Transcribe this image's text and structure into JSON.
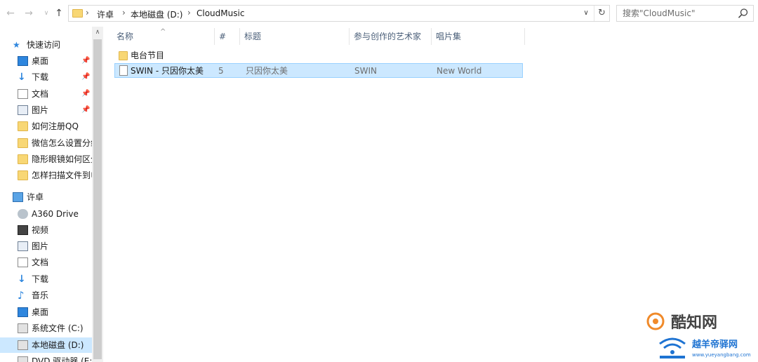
{
  "toolbar": {
    "back_icon": "arrow-left-icon",
    "forward_icon": "arrow-right-icon",
    "recent_icon": "chevron-down-icon",
    "up_icon": "arrow-up-icon"
  },
  "address": {
    "breadcrumbs": [
      "许卓",
      "本地磁盘 (D:)",
      "CloudMusic"
    ],
    "dropdown_icon": "chevron-down-icon",
    "refresh_icon": "refresh-icon"
  },
  "search": {
    "placeholder": "搜索\"CloudMusic\"",
    "icon": "search-icon"
  },
  "sidebar": {
    "quick_access": {
      "label": "快速访问",
      "items": [
        {
          "label": "桌面",
          "icon": "desktop-icon",
          "pinned": true
        },
        {
          "label": "下载",
          "icon": "download-icon",
          "pinned": true
        },
        {
          "label": "文档",
          "icon": "document-icon",
          "pinned": true
        },
        {
          "label": "图片",
          "icon": "pictures-icon",
          "pinned": true
        },
        {
          "label": "如何注册QQ",
          "icon": "folder-icon",
          "pinned": false
        },
        {
          "label": "微信怎么设置分组",
          "icon": "folder-icon",
          "pinned": false
        },
        {
          "label": "隐形眼镜如何区分",
          "icon": "folder-icon",
          "pinned": false
        },
        {
          "label": "怎样扫描文件到电脑",
          "icon": "folder-icon",
          "pinned": false
        }
      ]
    },
    "this_pc": {
      "label": "许卓",
      "items": [
        {
          "label": "A360 Drive",
          "icon": "cloud-drive-icon"
        },
        {
          "label": "视频",
          "icon": "video-icon"
        },
        {
          "label": "图片",
          "icon": "pictures-icon"
        },
        {
          "label": "文档",
          "icon": "document-icon"
        },
        {
          "label": "下载",
          "icon": "download-icon"
        },
        {
          "label": "音乐",
          "icon": "music-icon"
        },
        {
          "label": "桌面",
          "icon": "desktop-icon"
        },
        {
          "label": "系统文件 (C:)",
          "icon": "drive-icon"
        },
        {
          "label": "本地磁盘 (D:)",
          "icon": "drive-icon",
          "selected": true
        },
        {
          "label": "DVD 驱动器 (E:)",
          "icon": "dvd-drive-icon"
        }
      ]
    }
  },
  "file_list": {
    "columns": [
      "名称",
      "#",
      "标题",
      "参与创作的艺术家",
      "唱片集"
    ],
    "rows": [
      {
        "name": "电台节目",
        "type": "folder",
        "track": "",
        "title": "",
        "artist": "",
        "album": ""
      },
      {
        "name": "SWIN - 只因你太美",
        "type": "file",
        "track": "5",
        "title": "只因你太美",
        "artist": "SWIN",
        "album": "New World",
        "selected": true
      }
    ]
  },
  "watermark": {
    "brand1": "酷知网",
    "brand2": "越羊帝驿网",
    "url": "www.yueyangbang.com"
  },
  "colors": {
    "selection": "#cce8ff",
    "selection_border": "#99d1ff",
    "header_text": "#4c607a",
    "accent": "#2e86de"
  }
}
